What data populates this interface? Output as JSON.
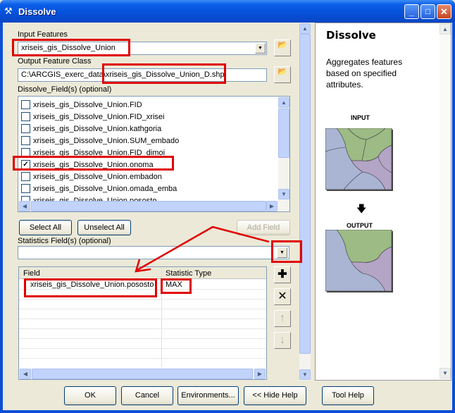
{
  "window": {
    "title": "Dissolve",
    "minimize": "_",
    "maximize": "□",
    "close": "✕"
  },
  "input_features": {
    "label": "Input Features",
    "value": "xriseis_gis_Dissolve_Union"
  },
  "output_feature_class": {
    "label": "Output Feature Class",
    "value": "C:\\ARCGIS_exerc_data\\xriseis_gis_Dissolve_Union_D.shp"
  },
  "dissolve_fields": {
    "label": "Dissolve_Field(s) (optional)",
    "items": [
      {
        "label": "xriseis_gis_Dissolve_Union.FID",
        "checked": false
      },
      {
        "label": "xriseis_gis_Dissolve_Union.FID_xrisei",
        "checked": false
      },
      {
        "label": "xriseis_gis_Dissolve_Union.kathgoria",
        "checked": false
      },
      {
        "label": "xriseis_gis_Dissolve_Union.SUM_embado",
        "checked": false
      },
      {
        "label": "xriseis_gis_Dissolve_Union.FID_dimoi_",
        "checked": false
      },
      {
        "label": "xriseis_gis_Dissolve_Union.onoma",
        "checked": true
      },
      {
        "label": "xriseis_gis_Dissolve_Union.embadon",
        "checked": false
      },
      {
        "label": "xriseis_gis_Dissolve_Union.omada_emba",
        "checked": false
      },
      {
        "label": "xriseis_gis_Dissolve_Union.pososto",
        "checked": false
      }
    ]
  },
  "buttons": {
    "select_all": "Select All",
    "unselect_all": "Unselect All",
    "add_field": "Add Field",
    "ok": "OK",
    "cancel": "Cancel",
    "environments": "Environments...",
    "hide_help": "<< Hide Help",
    "tool_help": "Tool Help"
  },
  "statistics": {
    "label": "Statistics Field(s) (optional)",
    "value": "",
    "columns": [
      "Field",
      "Statistic Type"
    ],
    "rows": [
      {
        "field": "xriseis_gis_Dissolve_Union.pososto",
        "type": "MAX"
      }
    ]
  },
  "help": {
    "title": "Dissolve",
    "description": "Aggregates features based on specified attributes.",
    "input_label": "INPUT",
    "output_label": "OUTPUT"
  },
  "colors": {
    "annotation": "#e00000",
    "green": "#9dbb85",
    "blue": "#a9b5d3",
    "purple": "#b4a5c7"
  }
}
